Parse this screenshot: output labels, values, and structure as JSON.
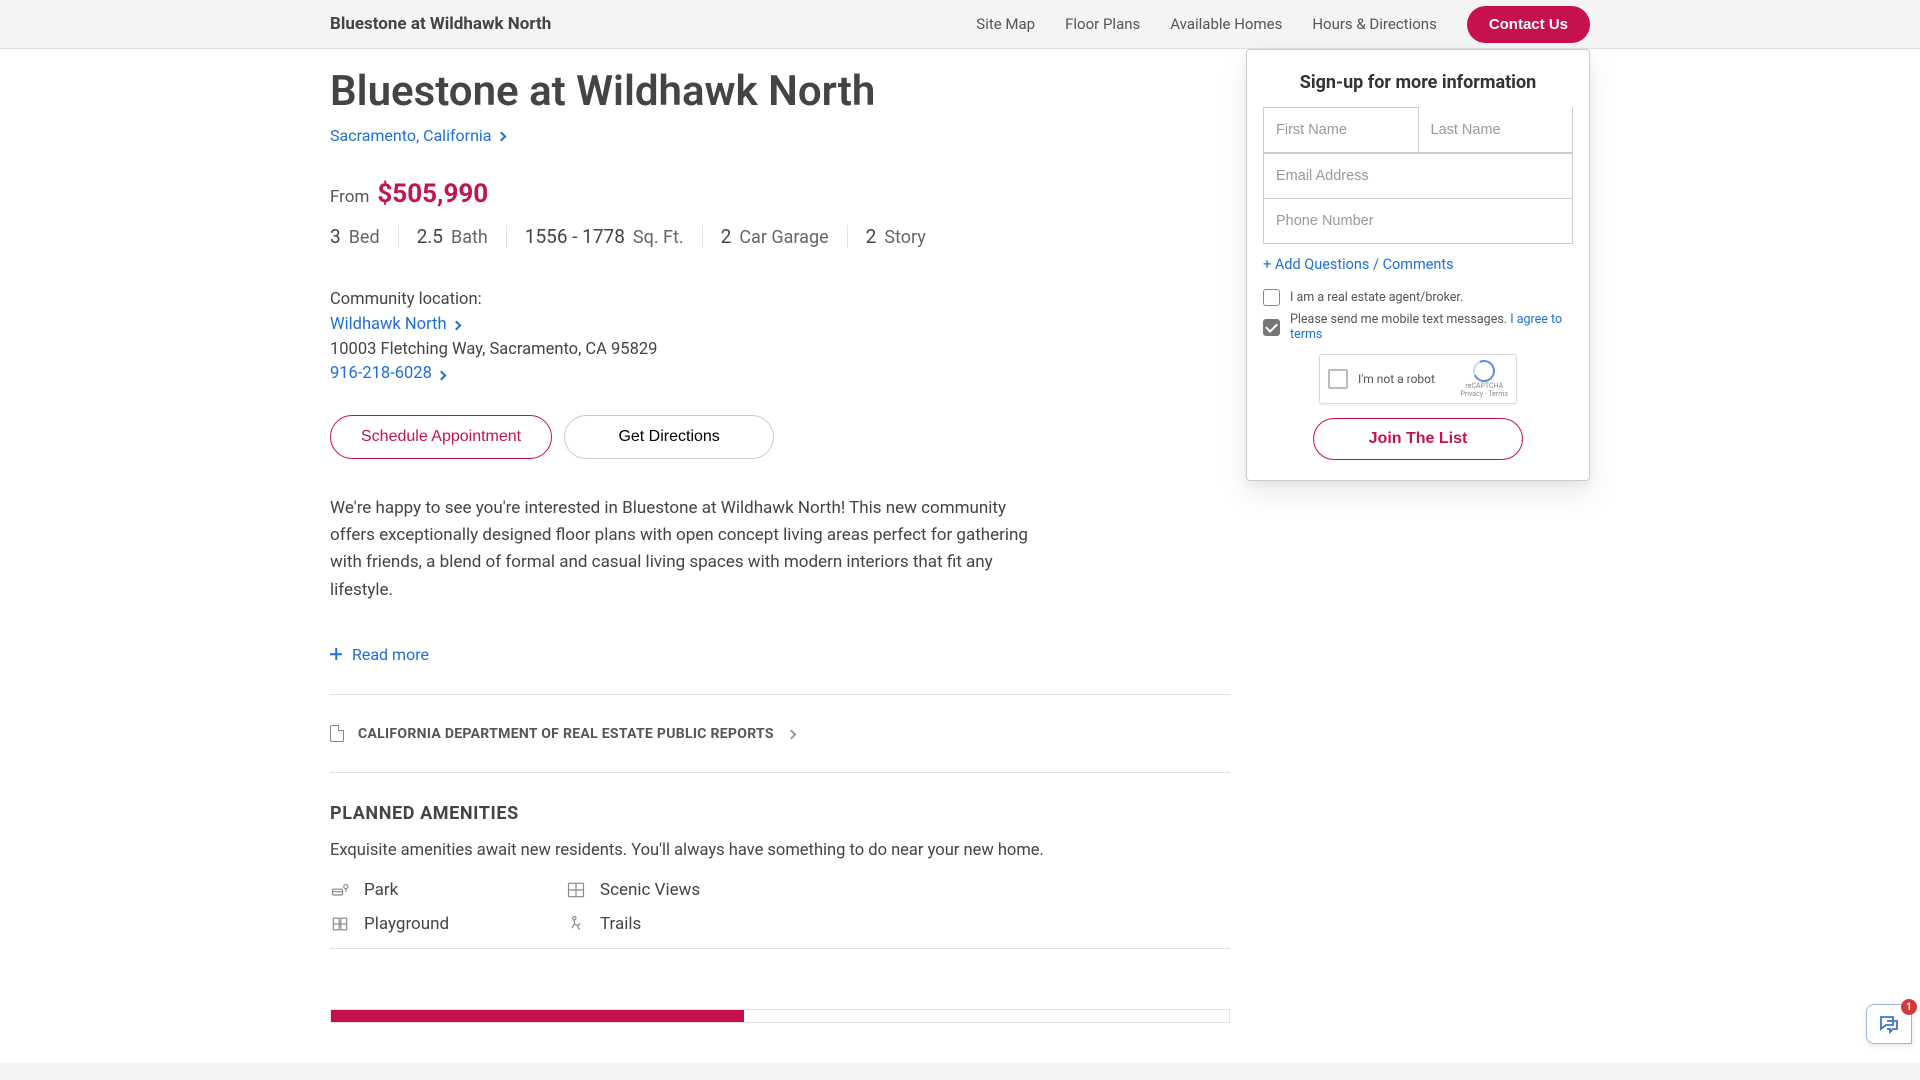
{
  "header": {
    "brand": "Bluestone at Wildhawk North",
    "nav": {
      "site_map": "Site Map",
      "floor_plans": "Floor Plans",
      "available_homes": "Available Homes",
      "hours": "Hours & Directions",
      "contact": "Contact Us"
    }
  },
  "main": {
    "title": "Bluestone at Wildhawk North",
    "location_link": "Sacramento, California",
    "price_from_label": "From",
    "price": "$505,990",
    "specs": {
      "bed": {
        "value": "3",
        "label": "Bed"
      },
      "bath": {
        "value": "2.5",
        "label": "Bath"
      },
      "sqft": {
        "value": "1556 - 1778",
        "label": "Sq. Ft."
      },
      "garage": {
        "value": "2",
        "label": "Car Garage"
      },
      "story": {
        "value": "2",
        "label": "Story"
      }
    },
    "community": {
      "label": "Community location:",
      "name": "Wildhawk North",
      "address": "10003 Fletching Way, Sacramento, CA 95829",
      "phone": "916-218-6028"
    },
    "buttons": {
      "schedule": "Schedule Appointment",
      "directions": "Get Directions"
    },
    "description": "We're happy to see you're interested in Bluestone at Wildhawk North! This new community offers exceptionally designed floor plans with open concept living areas perfect for gathering with friends, a blend of formal and casual living spaces with modern interiors that fit any lifestyle.",
    "read_more": "Read more",
    "reports_link": "CALIFORNIA DEPARTMENT OF REAL ESTATE PUBLIC REPORTS",
    "amenities": {
      "heading": "PLANNED AMENITIES",
      "sub": "Exquisite amenities await new residents. You'll always have something to do near your new home.",
      "items": {
        "park": "Park",
        "scenic": "Scenic Views",
        "playground": "Playground",
        "trails": "Trails"
      }
    }
  },
  "form": {
    "title": "Sign-up for more information",
    "first_name_ph": "First Name",
    "last_name_ph": "Last Name",
    "email_ph": "Email Address",
    "phone_ph": "Phone Number",
    "add_questions": "+ Add Questions / Comments",
    "agent_label": "I am a real estate agent/broker.",
    "sms_label": "Please send me mobile text messages.",
    "terms_link": "I agree to terms",
    "recaptcha_label": "I'm not a robot",
    "recaptcha_brand": "reCAPTCHA",
    "recaptcha_small": "Privacy - Terms",
    "submit": "Join The List"
  },
  "chat": {
    "badge": "1"
  }
}
